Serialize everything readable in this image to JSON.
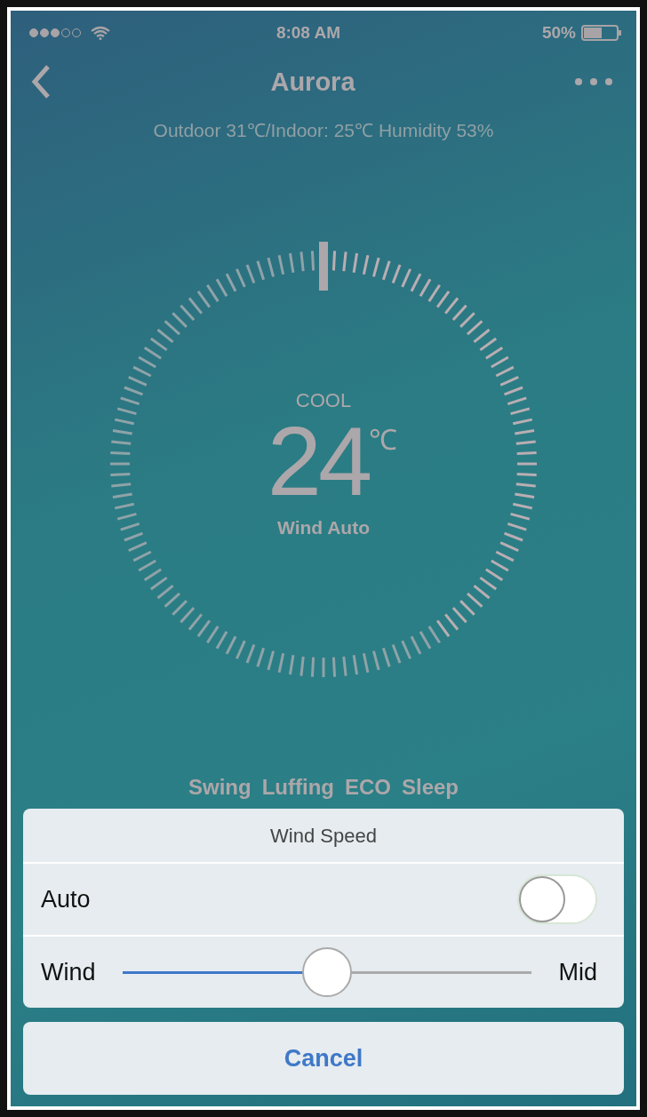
{
  "status_bar": {
    "time": "8:08 AM",
    "battery": "50%"
  },
  "nav": {
    "title": "Aurora",
    "subtitle": "Outdoor 31℃/Indoor: 25℃ Humidity 53%"
  },
  "dial": {
    "mode": "COOL",
    "temperature": "24",
    "unit": "℃",
    "wind": "Wind Auto"
  },
  "functions": [
    "Swing",
    "Luffing",
    "ECO",
    "Sleep"
  ],
  "sheet": {
    "title": "Wind Speed",
    "auto": {
      "label": "Auto",
      "on": false
    },
    "wind": {
      "label": "Wind",
      "level": 0.5,
      "reading": "Mid"
    },
    "cancel": "Cancel"
  }
}
